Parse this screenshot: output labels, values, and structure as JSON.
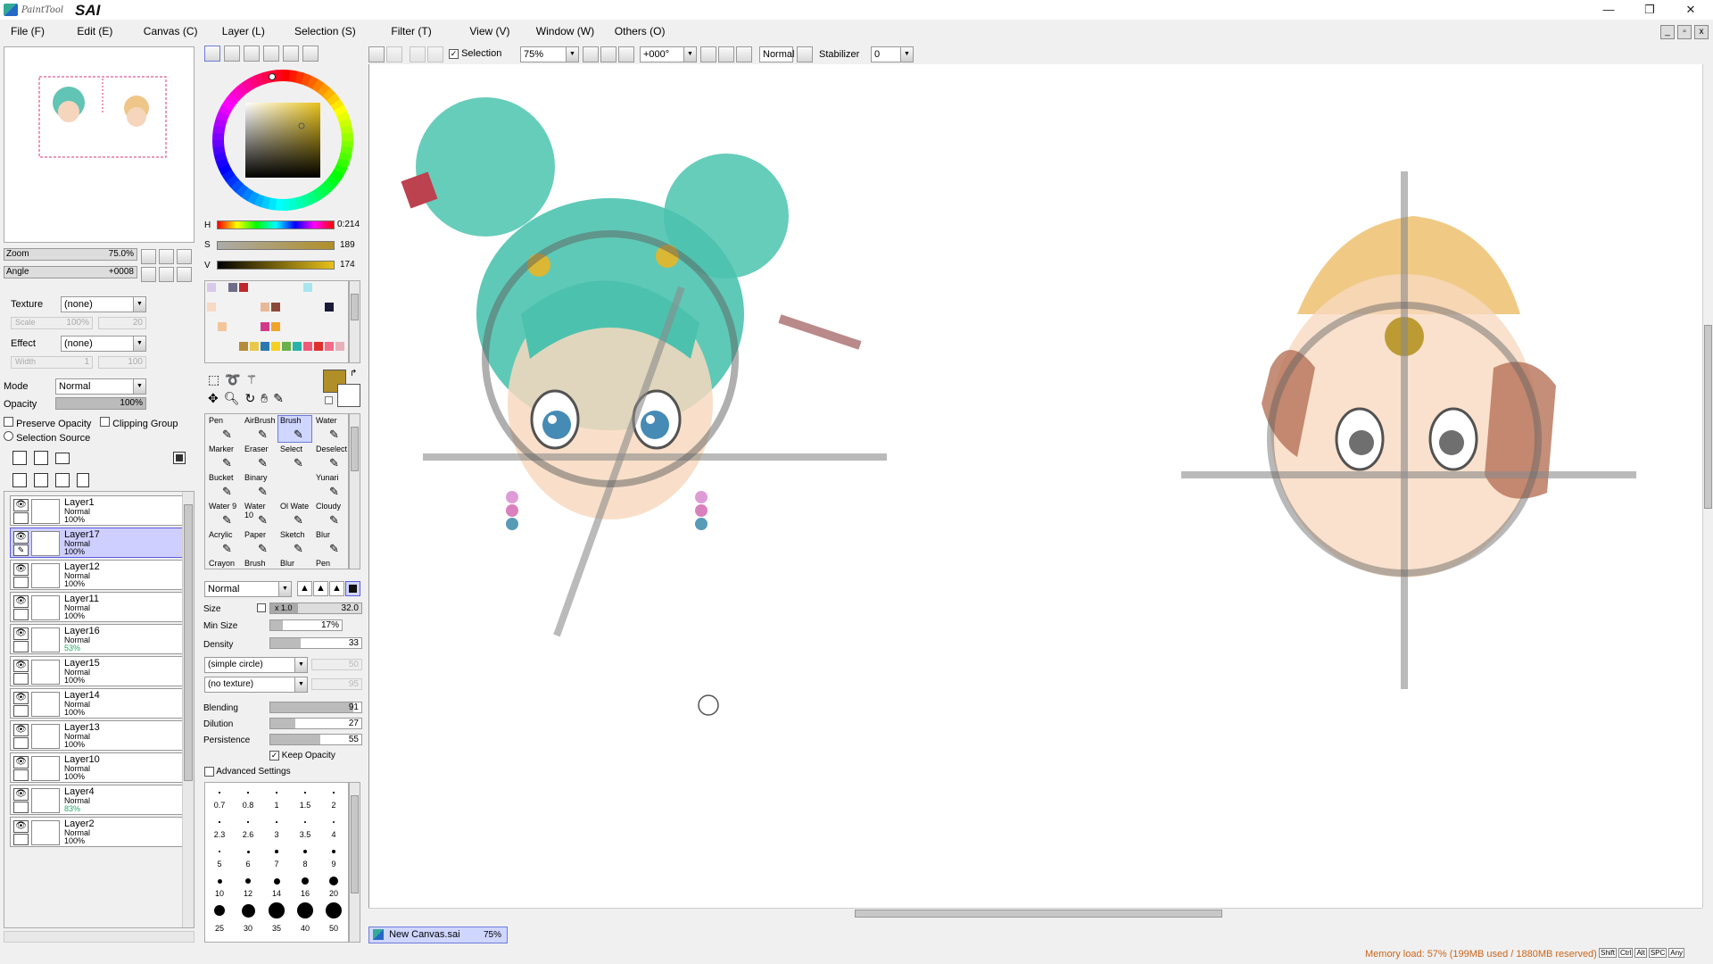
{
  "app": {
    "brand_small": "PaintTool",
    "brand_big": "SAI"
  },
  "window_controls": {
    "minimize": "—",
    "restore": "❐",
    "close": "✕"
  },
  "menu": [
    "File (F)",
    "Edit (E)",
    "Canvas (C)",
    "Layer (L)",
    "Selection (S)",
    "Filter (T)",
    "View (V)",
    "Window (W)",
    "Others (O)"
  ],
  "toolbar": {
    "selection_label": "Selection",
    "zoom": "75%",
    "angle": "+000°",
    "blend_mode": "Normal",
    "stabilizer_label": "Stabilizer",
    "stabilizer_value": "0"
  },
  "navigator": {
    "zoom_label": "Zoom",
    "zoom_value": "75.0%",
    "angle_label": "Angle",
    "angle_value": "+0008"
  },
  "paper": {
    "texture_label": "Texture",
    "texture_value": "(none)",
    "scale_label": "Scale",
    "scale_value": "100%",
    "scale_num": "20",
    "effect_label": "Effect",
    "effect_value": "(none)",
    "width_label": "Width",
    "width_value": "1",
    "width_num": "100"
  },
  "layer_props": {
    "mode_label": "Mode",
    "mode_value": "Normal",
    "opacity_label": "Opacity",
    "opacity_value": "100%",
    "preserve_opacity": "Preserve Opacity",
    "clipping_group": "Clipping Group",
    "selection_source": "Selection Source"
  },
  "layers": [
    {
      "name": "Layer1",
      "mode": "Normal",
      "opacity": "100%",
      "active": false
    },
    {
      "name": "Layer17",
      "mode": "Normal",
      "opacity": "100%",
      "active": true
    },
    {
      "name": "Layer12",
      "mode": "Normal",
      "opacity": "100%",
      "active": false
    },
    {
      "name": "Layer11",
      "mode": "Normal",
      "opacity": "100%",
      "active": false
    },
    {
      "name": "Layer16",
      "mode": "Normal",
      "opacity": "53%",
      "active": false
    },
    {
      "name": "Layer15",
      "mode": "Normal",
      "opacity": "100%",
      "active": false
    },
    {
      "name": "Layer14",
      "mode": "Normal",
      "opacity": "100%",
      "active": false
    },
    {
      "name": "Layer13",
      "mode": "Normal",
      "opacity": "100%",
      "active": false
    },
    {
      "name": "Layer10",
      "mode": "Normal",
      "opacity": "100%",
      "active": false
    },
    {
      "name": "Layer4",
      "mode": "Normal",
      "opacity": "83%",
      "active": false
    },
    {
      "name": "Layer2",
      "mode": "Normal",
      "opacity": "100%",
      "active": false
    }
  ],
  "color": {
    "h_label": "H",
    "h_value": "0:214",
    "s_label": "S",
    "s_value": "189",
    "v_label": "V",
    "v_value": "174",
    "primary": "#b18f28",
    "secondary": "#ffffff"
  },
  "swatches": [
    "#d9c9e8",
    "#f2f2f2",
    "#6e6e8a",
    "#c0272d",
    "#f2f2f2",
    "#f2f2f2",
    "#f2f2f2",
    "#f2f2f2",
    "#f2f2f2",
    "#a8e5ef",
    "#f2f2f2",
    "#f2f2f2",
    "#f2f2f2",
    "#f7d9c4",
    "#f2f2f2",
    "#f2f2f2",
    "#f2f2f2",
    "#f2f2f2",
    "#e8b89a",
    "#8b4a3a",
    "#f2f2f2",
    "#f2f2f2",
    "#f2f2f2",
    "#f2f2f2",
    "#1a1a3a",
    "#f2f2f2",
    "#f2f2f2",
    "#f3c59a",
    "#f2f2f2",
    "#f2f2f2",
    "#f2f2f2",
    "#d23a8a",
    "#f0a52a",
    "#f2f2f2",
    "#f2f2f2",
    "#f2f2f2",
    "#f2f2f2",
    "#f2f2f2",
    "#f2f2f2",
    "#f2f2f2",
    "#f2f2f2",
    "#f2f2f2",
    "#b78a3a",
    "#e8c84a",
    "#2a7ab0",
    "#f5d020",
    "#6ab04c",
    "#27b3a8",
    "#f05a78",
    "#e0302e",
    "#f36c8a",
    "#e8b0b8"
  ],
  "tools": [
    {
      "name": "Pen",
      "active": false
    },
    {
      "name": "AirBrush",
      "active": false
    },
    {
      "name": "Brush",
      "active": true
    },
    {
      "name": "Water",
      "active": false
    },
    {
      "name": "Marker",
      "active": false
    },
    {
      "name": "Eraser",
      "active": false
    },
    {
      "name": "Select",
      "active": false
    },
    {
      "name": "Deselect",
      "active": false
    },
    {
      "name": "Bucket",
      "active": false
    },
    {
      "name": "Binary",
      "active": false
    },
    {
      "name": "",
      "active": false
    },
    {
      "name": "Yunari",
      "active": false
    },
    {
      "name": "Water 9",
      "active": false
    },
    {
      "name": "Water 10",
      "active": false
    },
    {
      "name": "Ol Wate",
      "active": false
    },
    {
      "name": "Cloudy",
      "active": false
    },
    {
      "name": "Acrylic",
      "active": false
    },
    {
      "name": "Paper",
      "active": false
    },
    {
      "name": "Sketch",
      "active": false
    },
    {
      "name": "Blur",
      "active": false
    },
    {
      "name": "Crayon",
      "active": false
    },
    {
      "name": "Brush",
      "active": false
    },
    {
      "name": "Blur",
      "active": false
    },
    {
      "name": "Pen",
      "active": false
    }
  ],
  "brush": {
    "mode": "Normal",
    "size_label": "Size",
    "size_mult": "x 1.0",
    "size_value": "32.0",
    "min_size_label": "Min Size",
    "min_size_value": "17%",
    "density_label": "Density",
    "density_value": "33",
    "shape": "(simple circle)",
    "shape_num": "50",
    "texture": "(no texture)",
    "texture_num": "95",
    "blending_label": "Blending",
    "blending_value": "91",
    "dilution_label": "Dilution",
    "dilution_value": "27",
    "persistence_label": "Persistence",
    "persistence_value": "55",
    "keep_opacity": "Keep Opacity",
    "advanced": "Advanced Settings"
  },
  "brush_sizes": [
    "0.7",
    "0.8",
    "1",
    "1.5",
    "2",
    "2.3",
    "2.6",
    "3",
    "3.5",
    "4",
    "5",
    "6",
    "7",
    "8",
    "9",
    "10",
    "12",
    "14",
    "16",
    "20",
    "25",
    "30",
    "35",
    "40",
    "50"
  ],
  "doc_tab": {
    "name": "New Canvas.sai",
    "zoom": "75%"
  },
  "status": {
    "memory": "Memory load: 57% (199MB used / 1880MB reserved)",
    "keys": [
      "Shift",
      "Ctrl",
      "Alt",
      "SPC",
      "Any"
    ]
  }
}
